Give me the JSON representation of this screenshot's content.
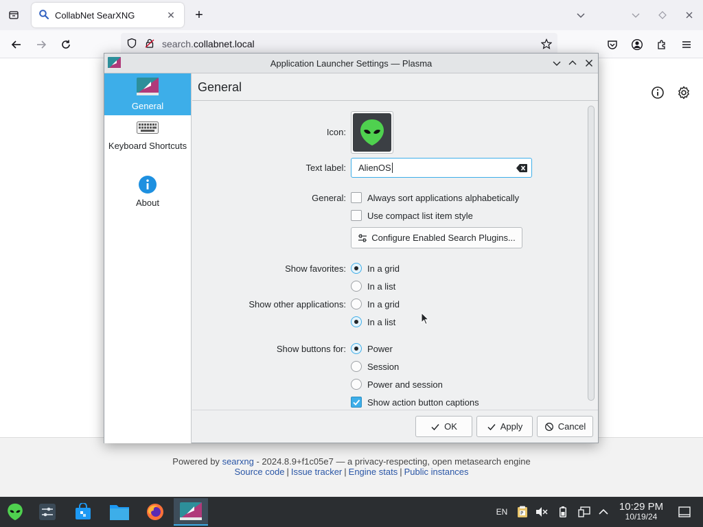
{
  "browser": {
    "tab_title": "CollabNet SearXNG",
    "url_prefix": "search.",
    "url_domain": "collabnet.local"
  },
  "page": {
    "footer_powered_by": "Powered by",
    "footer_searxng": "searxng",
    "footer_version_text": "- 2024.8.9+f1c05e7 — a privacy-respecting, open metasearch engine",
    "footer_links": [
      "Source code",
      "Issue tracker",
      "Engine stats",
      "Public instances"
    ],
    "footer_sep": "|"
  },
  "dialog": {
    "title": "Application Launcher Settings — Plasma",
    "sidebar": [
      {
        "label": "General",
        "active": true,
        "icon": "kickoff-icon"
      },
      {
        "label": "Keyboard Shortcuts",
        "active": false,
        "icon": "keyboard-icon"
      },
      {
        "label": "About",
        "active": false,
        "icon": "info-icon"
      }
    ],
    "page_title": "General",
    "icon_label": "Icon:",
    "text_label_label": "Text label:",
    "text_label_value": "AlienOS",
    "general_label": "General:",
    "sort_alpha_label": "Always sort applications alphabetically",
    "sort_alpha_checked": false,
    "compact_label": "Use compact list item style",
    "compact_checked": false,
    "configure_plugins_label": "Configure Enabled Search Plugins...",
    "show_favorites_label": "Show favorites:",
    "favorites_grid_label": "In a grid",
    "favorites_list_label": "In a list",
    "favorites_selected": "grid",
    "show_other_label": "Show other applications:",
    "other_grid_label": "In a grid",
    "other_list_label": "In a list",
    "other_selected": "list",
    "show_buttons_label": "Show buttons for:",
    "buttons_power_label": "Power",
    "buttons_session_label": "Session",
    "buttons_power_session_label": "Power and session",
    "buttons_selected": "power",
    "captions_label": "Show action button captions",
    "captions_checked": true,
    "ok_label": "OK",
    "apply_label": "Apply",
    "cancel_label": "Cancel"
  },
  "taskbar": {
    "keyboard_layout": "EN",
    "time": "10:29 PM",
    "date": "10/19/24"
  },
  "colors": {
    "accent": "#3daee9",
    "link": "#2a56a6",
    "taskbar": "#2b2e31"
  }
}
